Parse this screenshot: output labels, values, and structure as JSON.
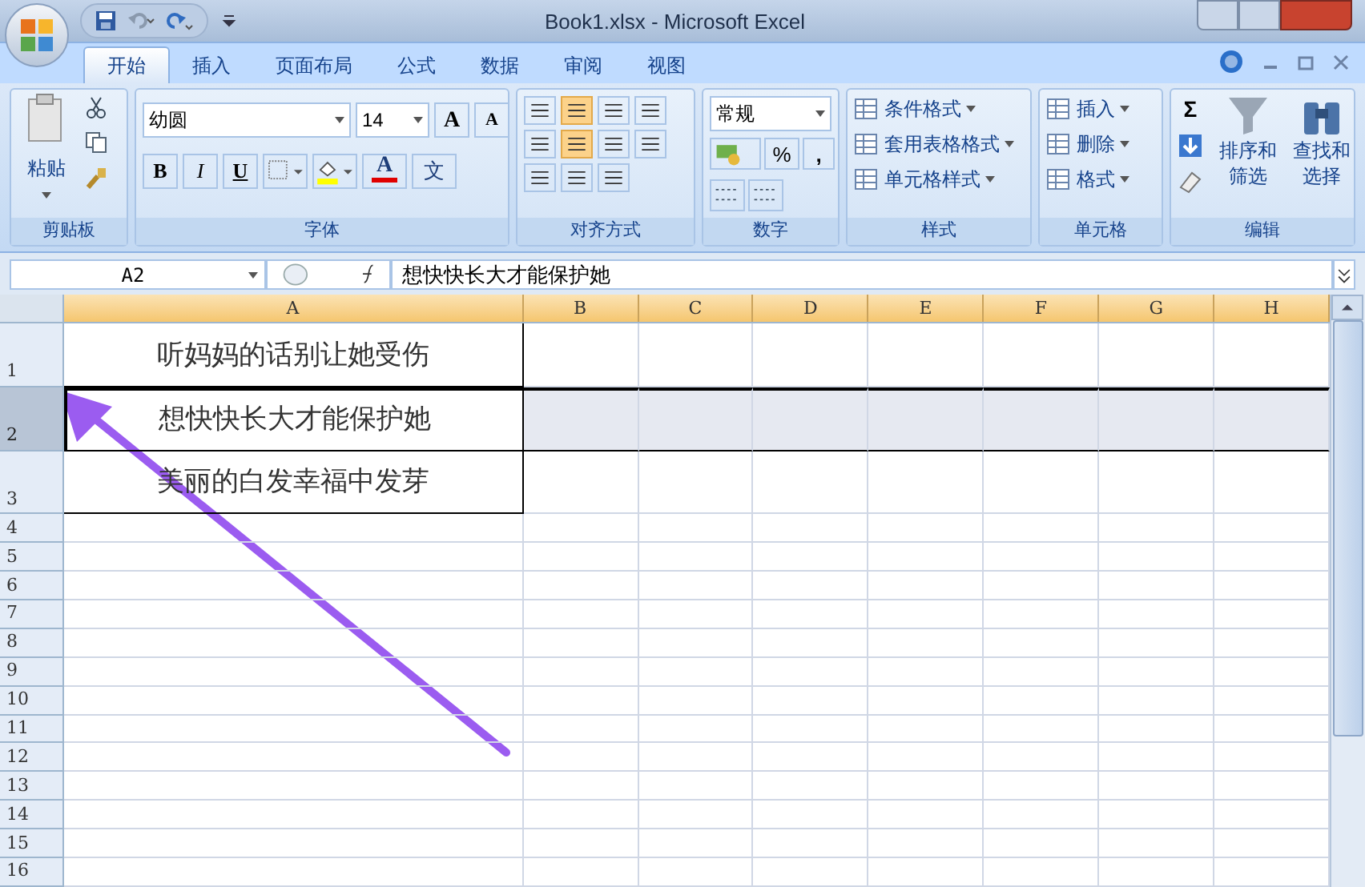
{
  "window": {
    "title": "Book1.xlsx - Microsoft Excel"
  },
  "tabs": [
    {
      "label": "开始",
      "selected": true
    },
    {
      "label": "插入",
      "selected": false
    },
    {
      "label": "页面布局",
      "selected": false
    },
    {
      "label": "公式",
      "selected": false
    },
    {
      "label": "数据",
      "selected": false
    },
    {
      "label": "审阅",
      "selected": false
    },
    {
      "label": "视图",
      "selected": false
    }
  ],
  "ribbon": [
    {
      "kind": "clipboard",
      "label": "剪贴板",
      "paste": "粘贴"
    },
    {
      "kind": "font",
      "label": "字体",
      "font_name": "幼圆",
      "font_size": "14",
      "grow": "A",
      "shrink": "A",
      "bold": "B",
      "italic": "I",
      "underline": "U",
      "font_color": "A",
      "phonetic": "文"
    },
    {
      "kind": "alignment",
      "label": "对齐方式"
    },
    {
      "kind": "number",
      "label": "数字",
      "format": "常规",
      "percent": "%",
      "comma": ","
    },
    {
      "kind": "styles",
      "label": "样式",
      "items": [
        "条件格式",
        "套用表格格式",
        "单元格样式"
      ]
    },
    {
      "kind": "cells",
      "label": "单元格",
      "items": [
        "插入",
        "删除",
        "格式"
      ]
    },
    {
      "kind": "editing",
      "label": "编辑",
      "sigma": "Σ",
      "sort": [
        "排序和",
        "筛选"
      ],
      "find": [
        "查找和",
        "选择"
      ]
    }
  ],
  "name_box": "A2",
  "formula": "想快快长大才能保护她",
  "columns": [
    "A",
    "B",
    "C",
    "D",
    "E",
    "F",
    "G",
    "H"
  ],
  "rows": [
    {
      "header": "1",
      "selected": false,
      "cells": [
        "听妈妈的话别让她受伤"
      ]
    },
    {
      "header": "2",
      "selected": true,
      "cells": [
        "想快快长大才能保护她"
      ]
    },
    {
      "header": "3",
      "selected": false,
      "cells": [
        "美丽的白发幸福中发芽"
      ]
    },
    {
      "header": "4",
      "selected": false,
      "cells": []
    },
    {
      "header": "5",
      "selected": false,
      "cells": []
    },
    {
      "header": "6",
      "selected": false,
      "cells": []
    },
    {
      "header": "7",
      "selected": false,
      "cells": []
    },
    {
      "header": "8",
      "selected": false,
      "cells": []
    },
    {
      "header": "9",
      "selected": false,
      "cells": []
    },
    {
      "header": "10",
      "selected": false,
      "cells": []
    },
    {
      "header": "11",
      "selected": false,
      "cells": []
    },
    {
      "header": "12",
      "selected": false,
      "cells": []
    },
    {
      "header": "13",
      "selected": false,
      "cells": []
    },
    {
      "header": "14",
      "selected": false,
      "cells": []
    },
    {
      "header": "15",
      "selected": false,
      "cells": []
    },
    {
      "header": "16",
      "selected": false,
      "cells": []
    }
  ]
}
